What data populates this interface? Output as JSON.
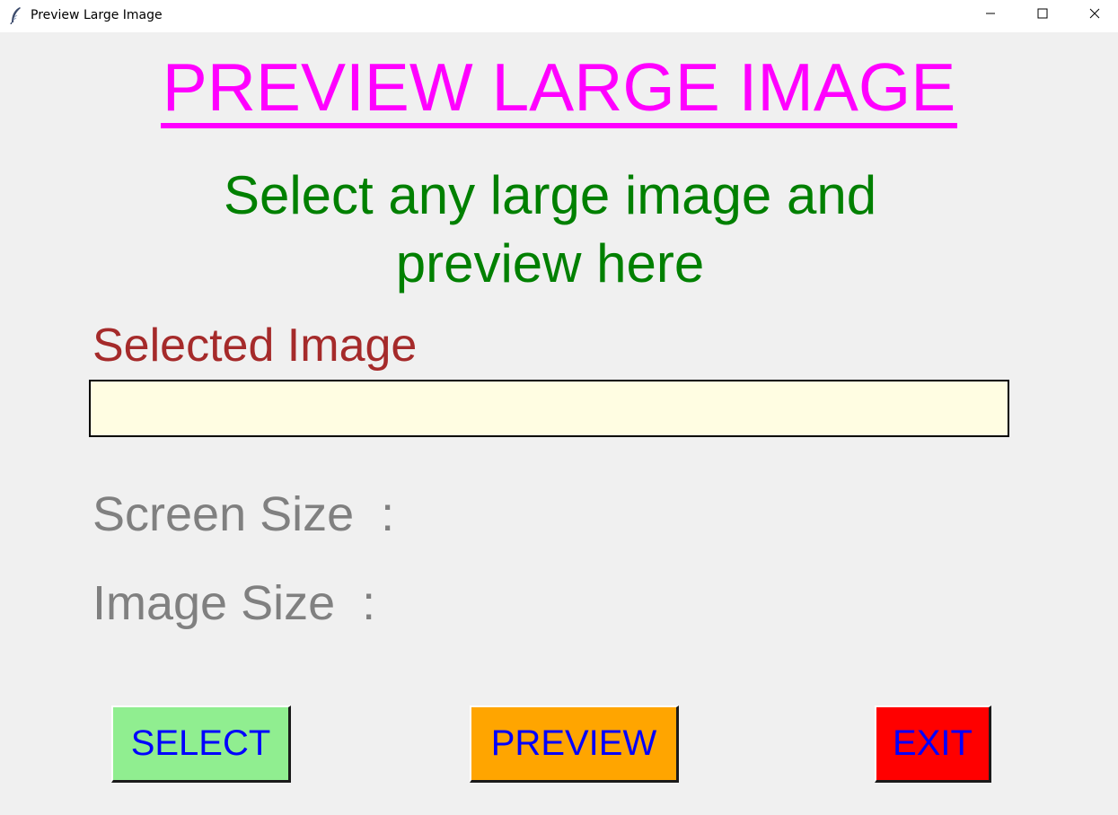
{
  "window": {
    "title": "Preview Large Image",
    "controls": {
      "minimize_icon": "minimize-icon",
      "maximize_icon": "maximize-icon",
      "close_icon": "close-icon"
    },
    "app_icon": "feather-icon"
  },
  "main": {
    "heading": "PREVIEW LARGE IMAGE",
    "subheading_line1": "Select any large image and",
    "subheading_line2": "preview here",
    "selected_label": "Selected Image",
    "path_field": {
      "value": "",
      "placeholder": ""
    },
    "screen_size_label": "Screen Size  :",
    "image_size_label": "Image Size  :"
  },
  "buttons": {
    "select": "SELECT",
    "preview": "PREVIEW",
    "exit": "EXIT"
  },
  "colors": {
    "heading": "#ff00ff",
    "subheading": "#008000",
    "selected_label": "#a52a2a",
    "info_label": "#808080",
    "field_background": "#fffde2",
    "button_text": "#0000ff",
    "select_button": "#90ee90",
    "preview_button": "#ffa500",
    "exit_button": "#ff0000"
  }
}
